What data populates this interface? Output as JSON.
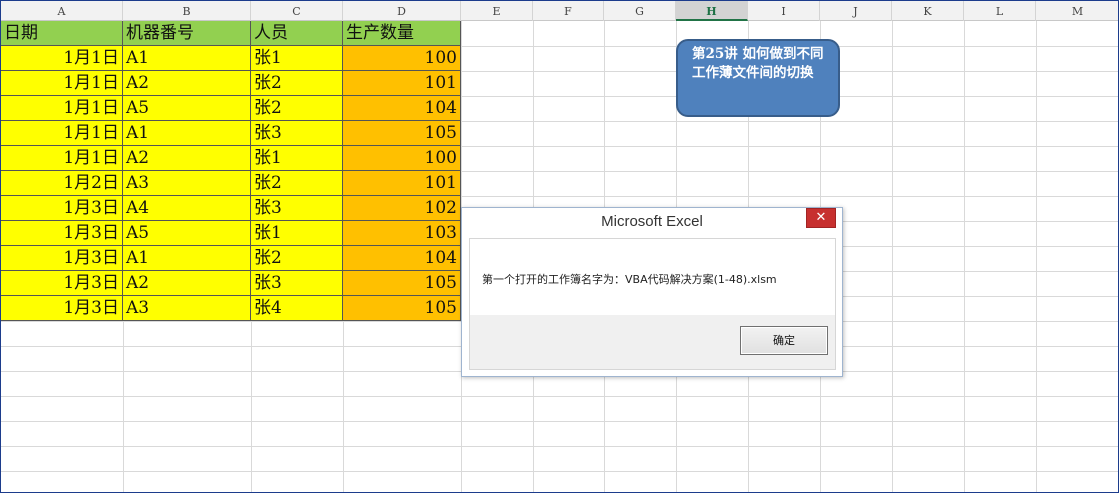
{
  "columns": [
    "A",
    "B",
    "C",
    "D",
    "E",
    "F",
    "G",
    "H",
    "I",
    "J",
    "K",
    "L",
    "M"
  ],
  "selected_column": "H",
  "table": {
    "headers": [
      "日期",
      "机器番号",
      "人员",
      "生产数量"
    ],
    "rows": [
      [
        "1月1日",
        "A1",
        "张1",
        "100"
      ],
      [
        "1月1日",
        "A2",
        "张2",
        "101"
      ],
      [
        "1月1日",
        "A5",
        "张2",
        "104"
      ],
      [
        "1月1日",
        "A1",
        "张3",
        "105"
      ],
      [
        "1月1日",
        "A2",
        "张1",
        "100"
      ],
      [
        "1月2日",
        "A3",
        "张2",
        "101"
      ],
      [
        "1月3日",
        "A4",
        "张3",
        "102"
      ],
      [
        "1月3日",
        "A5",
        "张1",
        "103"
      ],
      [
        "1月3日",
        "A1",
        "张2",
        "104"
      ],
      [
        "1月3日",
        "A2",
        "张3",
        "105"
      ],
      [
        "1月3日",
        "A3",
        "张4",
        "105"
      ]
    ]
  },
  "callout": {
    "text": "第25讲 如何做到不同工作薄文件间的切换"
  },
  "dialog": {
    "title": "Microsoft Excel",
    "message": "第一个打开的工作簿名字为：VBA代码解决方案(1-48).xlsm",
    "ok_label": "确定",
    "close_glyph": "✕"
  },
  "colors": {
    "header_fill": "#92d050",
    "text_fill": "#ffff00",
    "number_fill": "#ffc000",
    "callout_fill": "#4f81bd",
    "close_button": "#c7302f"
  }
}
